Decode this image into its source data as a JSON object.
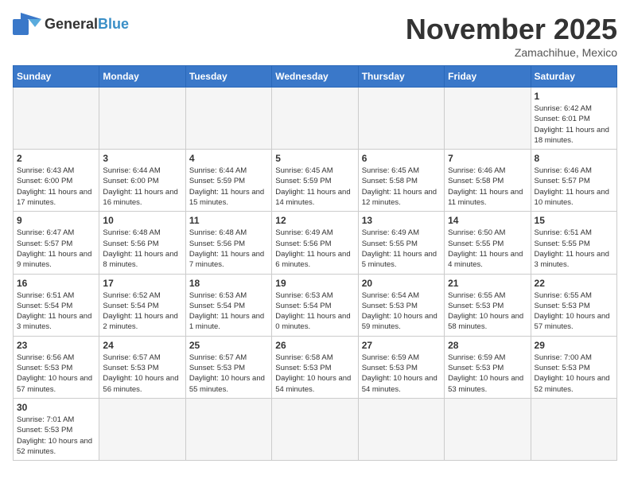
{
  "header": {
    "logo_general": "General",
    "logo_blue": "Blue",
    "month_title": "November 2025",
    "location": "Zamachihue, Mexico"
  },
  "weekdays": [
    "Sunday",
    "Monday",
    "Tuesday",
    "Wednesday",
    "Thursday",
    "Friday",
    "Saturday"
  ],
  "days": [
    {
      "number": "",
      "info": ""
    },
    {
      "number": "",
      "info": ""
    },
    {
      "number": "",
      "info": ""
    },
    {
      "number": "",
      "info": ""
    },
    {
      "number": "",
      "info": ""
    },
    {
      "number": "",
      "info": ""
    },
    {
      "number": "1",
      "info": "Sunrise: 6:42 AM\nSunset: 6:01 PM\nDaylight: 11 hours and 18 minutes."
    },
    {
      "number": "2",
      "info": "Sunrise: 6:43 AM\nSunset: 6:00 PM\nDaylight: 11 hours and 17 minutes."
    },
    {
      "number": "3",
      "info": "Sunrise: 6:44 AM\nSunset: 6:00 PM\nDaylight: 11 hours and 16 minutes."
    },
    {
      "number": "4",
      "info": "Sunrise: 6:44 AM\nSunset: 5:59 PM\nDaylight: 11 hours and 15 minutes."
    },
    {
      "number": "5",
      "info": "Sunrise: 6:45 AM\nSunset: 5:59 PM\nDaylight: 11 hours and 14 minutes."
    },
    {
      "number": "6",
      "info": "Sunrise: 6:45 AM\nSunset: 5:58 PM\nDaylight: 11 hours and 12 minutes."
    },
    {
      "number": "7",
      "info": "Sunrise: 6:46 AM\nSunset: 5:58 PM\nDaylight: 11 hours and 11 minutes."
    },
    {
      "number": "8",
      "info": "Sunrise: 6:46 AM\nSunset: 5:57 PM\nDaylight: 11 hours and 10 minutes."
    },
    {
      "number": "9",
      "info": "Sunrise: 6:47 AM\nSunset: 5:57 PM\nDaylight: 11 hours and 9 minutes."
    },
    {
      "number": "10",
      "info": "Sunrise: 6:48 AM\nSunset: 5:56 PM\nDaylight: 11 hours and 8 minutes."
    },
    {
      "number": "11",
      "info": "Sunrise: 6:48 AM\nSunset: 5:56 PM\nDaylight: 11 hours and 7 minutes."
    },
    {
      "number": "12",
      "info": "Sunrise: 6:49 AM\nSunset: 5:56 PM\nDaylight: 11 hours and 6 minutes."
    },
    {
      "number": "13",
      "info": "Sunrise: 6:49 AM\nSunset: 5:55 PM\nDaylight: 11 hours and 5 minutes."
    },
    {
      "number": "14",
      "info": "Sunrise: 6:50 AM\nSunset: 5:55 PM\nDaylight: 11 hours and 4 minutes."
    },
    {
      "number": "15",
      "info": "Sunrise: 6:51 AM\nSunset: 5:55 PM\nDaylight: 11 hours and 3 minutes."
    },
    {
      "number": "16",
      "info": "Sunrise: 6:51 AM\nSunset: 5:54 PM\nDaylight: 11 hours and 3 minutes."
    },
    {
      "number": "17",
      "info": "Sunrise: 6:52 AM\nSunset: 5:54 PM\nDaylight: 11 hours and 2 minutes."
    },
    {
      "number": "18",
      "info": "Sunrise: 6:53 AM\nSunset: 5:54 PM\nDaylight: 11 hours and 1 minute."
    },
    {
      "number": "19",
      "info": "Sunrise: 6:53 AM\nSunset: 5:54 PM\nDaylight: 11 hours and 0 minutes."
    },
    {
      "number": "20",
      "info": "Sunrise: 6:54 AM\nSunset: 5:53 PM\nDaylight: 10 hours and 59 minutes."
    },
    {
      "number": "21",
      "info": "Sunrise: 6:55 AM\nSunset: 5:53 PM\nDaylight: 10 hours and 58 minutes."
    },
    {
      "number": "22",
      "info": "Sunrise: 6:55 AM\nSunset: 5:53 PM\nDaylight: 10 hours and 57 minutes."
    },
    {
      "number": "23",
      "info": "Sunrise: 6:56 AM\nSunset: 5:53 PM\nDaylight: 10 hours and 57 minutes."
    },
    {
      "number": "24",
      "info": "Sunrise: 6:57 AM\nSunset: 5:53 PM\nDaylight: 10 hours and 56 minutes."
    },
    {
      "number": "25",
      "info": "Sunrise: 6:57 AM\nSunset: 5:53 PM\nDaylight: 10 hours and 55 minutes."
    },
    {
      "number": "26",
      "info": "Sunrise: 6:58 AM\nSunset: 5:53 PM\nDaylight: 10 hours and 54 minutes."
    },
    {
      "number": "27",
      "info": "Sunrise: 6:59 AM\nSunset: 5:53 PM\nDaylight: 10 hours and 54 minutes."
    },
    {
      "number": "28",
      "info": "Sunrise: 6:59 AM\nSunset: 5:53 PM\nDaylight: 10 hours and 53 minutes."
    },
    {
      "number": "29",
      "info": "Sunrise: 7:00 AM\nSunset: 5:53 PM\nDaylight: 10 hours and 52 minutes."
    },
    {
      "number": "30",
      "info": "Sunrise: 7:01 AM\nSunset: 5:53 PM\nDaylight: 10 hours and 52 minutes."
    },
    {
      "number": "",
      "info": ""
    },
    {
      "number": "",
      "info": ""
    },
    {
      "number": "",
      "info": ""
    },
    {
      "number": "",
      "info": ""
    },
    {
      "number": "",
      "info": ""
    },
    {
      "number": "",
      "info": ""
    }
  ]
}
